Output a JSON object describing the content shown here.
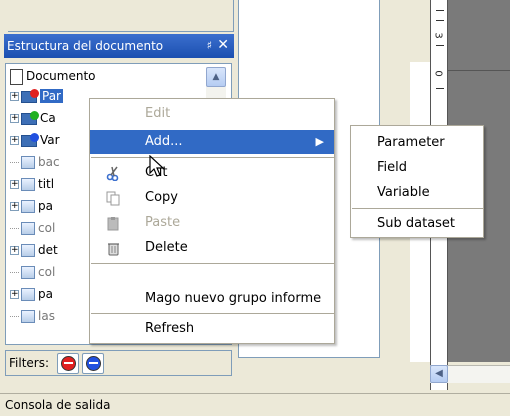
{
  "structure_panel": {
    "title": "Estructura del documento",
    "pin_glyph": "♯",
    "close_glyph": "✕"
  },
  "tree": {
    "root_label": "Documento",
    "items": [
      {
        "label": "Par"
      },
      {
        "label": "Ca"
      },
      {
        "label": "Var"
      },
      {
        "label": "bac"
      },
      {
        "label": "titl"
      },
      {
        "label": "pa"
      },
      {
        "label": "col"
      },
      {
        "label": "det"
      },
      {
        "label": "col"
      },
      {
        "label": "pa"
      },
      {
        "label": "las"
      }
    ],
    "scroll_up_glyph": "▲"
  },
  "filters": {
    "label": "Filters:"
  },
  "context_menu": {
    "items": [
      {
        "label": "Edit",
        "icon": "",
        "enabled": false,
        "highlighted": false
      },
      {
        "label": "Add...",
        "icon": "",
        "enabled": true,
        "highlighted": true,
        "submenu": true
      },
      {
        "label": "Cut",
        "icon": "scissors-icon",
        "enabled": true,
        "highlighted": false
      },
      {
        "label": "Copy",
        "icon": "copy-icon",
        "enabled": true,
        "highlighted": false
      },
      {
        "label": "Paste",
        "icon": "paste-icon",
        "enabled": false,
        "highlighted": false
      },
      {
        "label": "Delete",
        "icon": "trash-icon",
        "enabled": true,
        "highlighted": false
      },
      {
        "label": "Mago nuevo grupo informe",
        "icon": "",
        "enabled": true,
        "highlighted": false
      },
      {
        "label": "Refresh",
        "icon": "",
        "enabled": true,
        "highlighted": false
      }
    ],
    "submenu_arrow": "▶"
  },
  "add_submenu": {
    "items": [
      {
        "label": "Parameter"
      },
      {
        "label": "Field"
      },
      {
        "label": "Variable"
      },
      {
        "label": "Sub dataset"
      }
    ]
  },
  "ruler": {
    "numbers": [
      "3",
      "0"
    ]
  },
  "hscroll": {
    "left_glyph": "◀"
  },
  "console": {
    "title": "Consola de salida"
  },
  "colors": {
    "selection": "#316ac5",
    "titlebar": "#1b4fb0",
    "window_bg": "#ece9d8"
  }
}
